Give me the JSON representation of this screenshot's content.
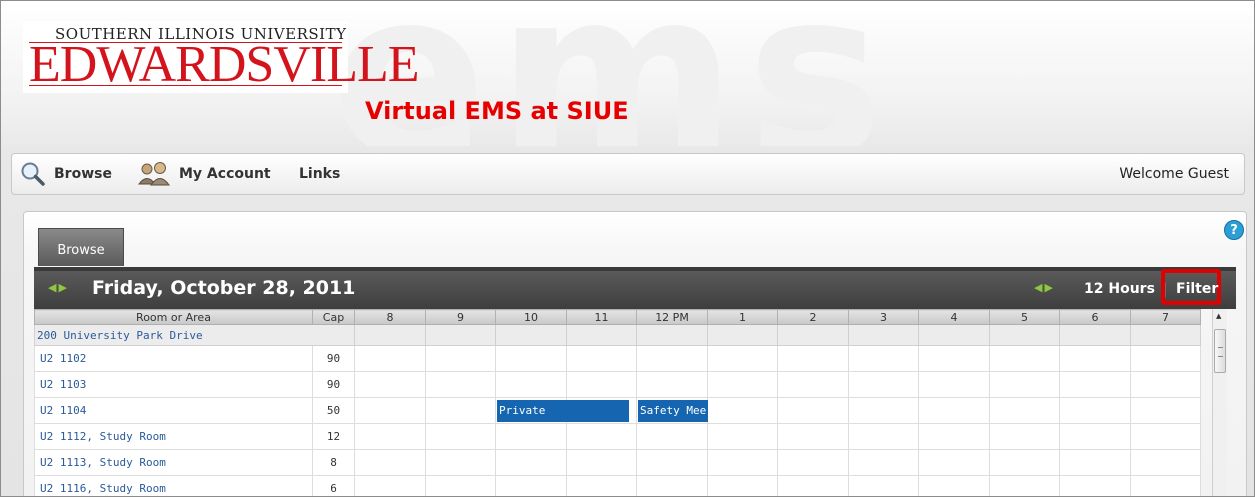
{
  "header": {
    "logo_top": "SOUTHERN ILLINOIS UNIVERSITY",
    "logo_main": "EDWARDSVILLE",
    "site_title": "Virtual EMS at SIUE",
    "watermark": "ems"
  },
  "nav": {
    "browse_label": "Browse",
    "account_label": "My Account",
    "links_label": "Links",
    "welcome": "Welcome Guest"
  },
  "panel": {
    "tab_label": "Browse",
    "help_glyph": "?",
    "date_title": "Friday, October 28, 2011",
    "hours_label": "12 Hours",
    "separator": "|",
    "filter_label": "Filter"
  },
  "grid": {
    "col_room": "Room or Area",
    "col_cap": "Cap",
    "hours": [
      "8",
      "9",
      "10",
      "11",
      "12 PM",
      "1",
      "2",
      "3",
      "4",
      "5",
      "6",
      "7"
    ],
    "group": "200 University Park Drive",
    "rows": [
      {
        "room": "U2 1102",
        "cap": "90"
      },
      {
        "room": "U2 1103",
        "cap": "90"
      },
      {
        "room": "U2 1104",
        "cap": "50"
      },
      {
        "room": "U2 1112, Study Room",
        "cap": "12"
      },
      {
        "room": "U2 1113, Study Room",
        "cap": "8"
      },
      {
        "room": "U2 1116, Study Room",
        "cap": "6"
      }
    ],
    "events": [
      {
        "label": "Private",
        "row": 2
      },
      {
        "label": "Safety Mee",
        "row": 2
      }
    ]
  },
  "colors": {
    "title_red": "#e60000",
    "logo_red": "#d4141c",
    "event_blue": "#1565b0",
    "arrow_green": "#8fc63f",
    "highlight_red": "#e00000"
  }
}
